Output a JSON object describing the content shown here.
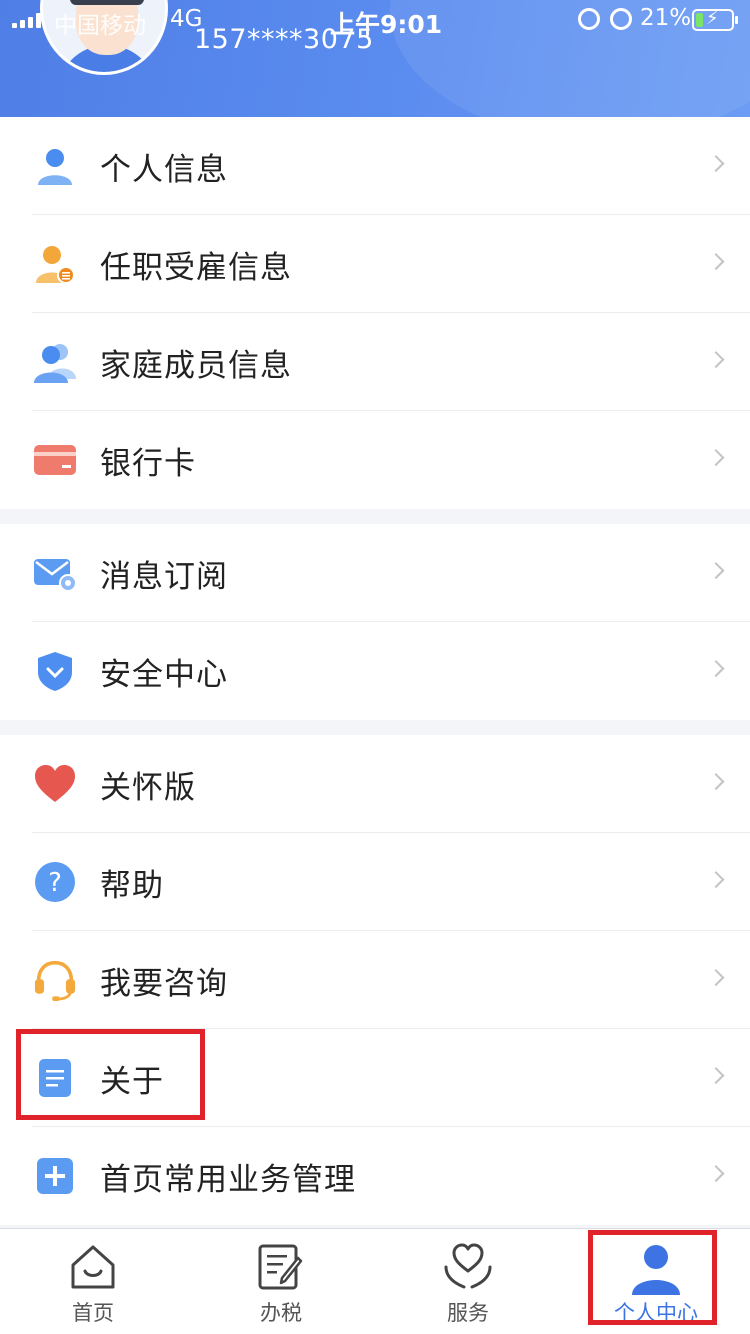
{
  "status_bar": {
    "carrier": "中国移动",
    "network": "4G",
    "time": "上午9:01",
    "battery": "21%"
  },
  "profile": {
    "phone": "157****3075"
  },
  "groups": [
    {
      "items": [
        {
          "label": "个人信息",
          "icon": "person-icon"
        },
        {
          "label": "任职受雇信息",
          "icon": "employment-icon"
        },
        {
          "label": "家庭成员信息",
          "icon": "family-members-icon"
        },
        {
          "label": "银行卡",
          "icon": "bank-card-icon"
        }
      ]
    },
    {
      "items": [
        {
          "label": "消息订阅",
          "icon": "mail-subscription-icon"
        },
        {
          "label": "安全中心",
          "icon": "shield-icon"
        }
      ]
    },
    {
      "items": [
        {
          "label": "关怀版",
          "icon": "heart-icon"
        },
        {
          "label": "帮助",
          "icon": "help-icon"
        },
        {
          "label": "我要咨询",
          "icon": "headset-icon"
        },
        {
          "label": "关于",
          "icon": "document-icon"
        },
        {
          "label": "首页常用业务管理",
          "icon": "plus-icon"
        }
      ]
    }
  ],
  "tabs": [
    {
      "label": "首页",
      "icon": "home-icon"
    },
    {
      "label": "办税",
      "icon": "tax-form-icon"
    },
    {
      "label": "服务",
      "icon": "service-heart-icon"
    },
    {
      "label": "个人中心",
      "icon": "user-center-icon"
    }
  ],
  "colors": {
    "header": "#5586ea",
    "accent": "#3e73e3",
    "highlight": "#e0222b"
  }
}
